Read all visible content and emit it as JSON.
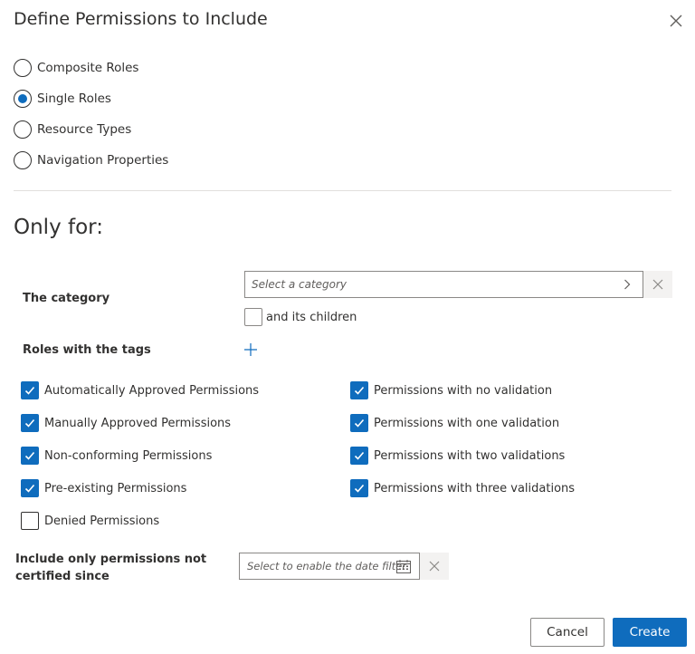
{
  "dialog": {
    "title": "Define Permissions to Include"
  },
  "radio_options": [
    {
      "label": "Composite Roles",
      "checked": false
    },
    {
      "label": "Single Roles",
      "checked": true
    },
    {
      "label": "Resource Types",
      "checked": false
    },
    {
      "label": "Navigation Properties",
      "checked": false
    }
  ],
  "only_for": {
    "title": "Only for:",
    "category_label": "The category",
    "category_placeholder": "Select a category",
    "children_label": "and its children",
    "children_checked": false,
    "tags_label": "Roles with the tags"
  },
  "permissions_left": [
    {
      "label": "Automatically Approved Permissions",
      "checked": true
    },
    {
      "label": "Manually Approved Permissions",
      "checked": true
    },
    {
      "label": "Non-conforming Permissions",
      "checked": true
    },
    {
      "label": "Pre-existing Permissions",
      "checked": true
    },
    {
      "label": "Denied Permissions",
      "checked": false
    }
  ],
  "permissions_right": [
    {
      "label": "Permissions with no validation",
      "checked": true
    },
    {
      "label": "Permissions with one validation",
      "checked": true
    },
    {
      "label": "Permissions with two validations",
      "checked": true
    },
    {
      "label": "Permissions with three validations",
      "checked": true
    }
  ],
  "certified": {
    "label_line1": "Include only permissions not",
    "label_line2": "certified since",
    "placeholder": "Select to enable the date filter"
  },
  "footer": {
    "cancel_label": "Cancel",
    "create_label": "Create"
  },
  "colors": {
    "accent": "#0f6cbd",
    "text": "#323130"
  },
  "icons": {
    "close": "close-icon",
    "chevron": "chevron-right-icon",
    "clear": "clear-icon",
    "add": "plus-icon",
    "calendar": "calendar-icon",
    "check": "checkmark-icon"
  }
}
